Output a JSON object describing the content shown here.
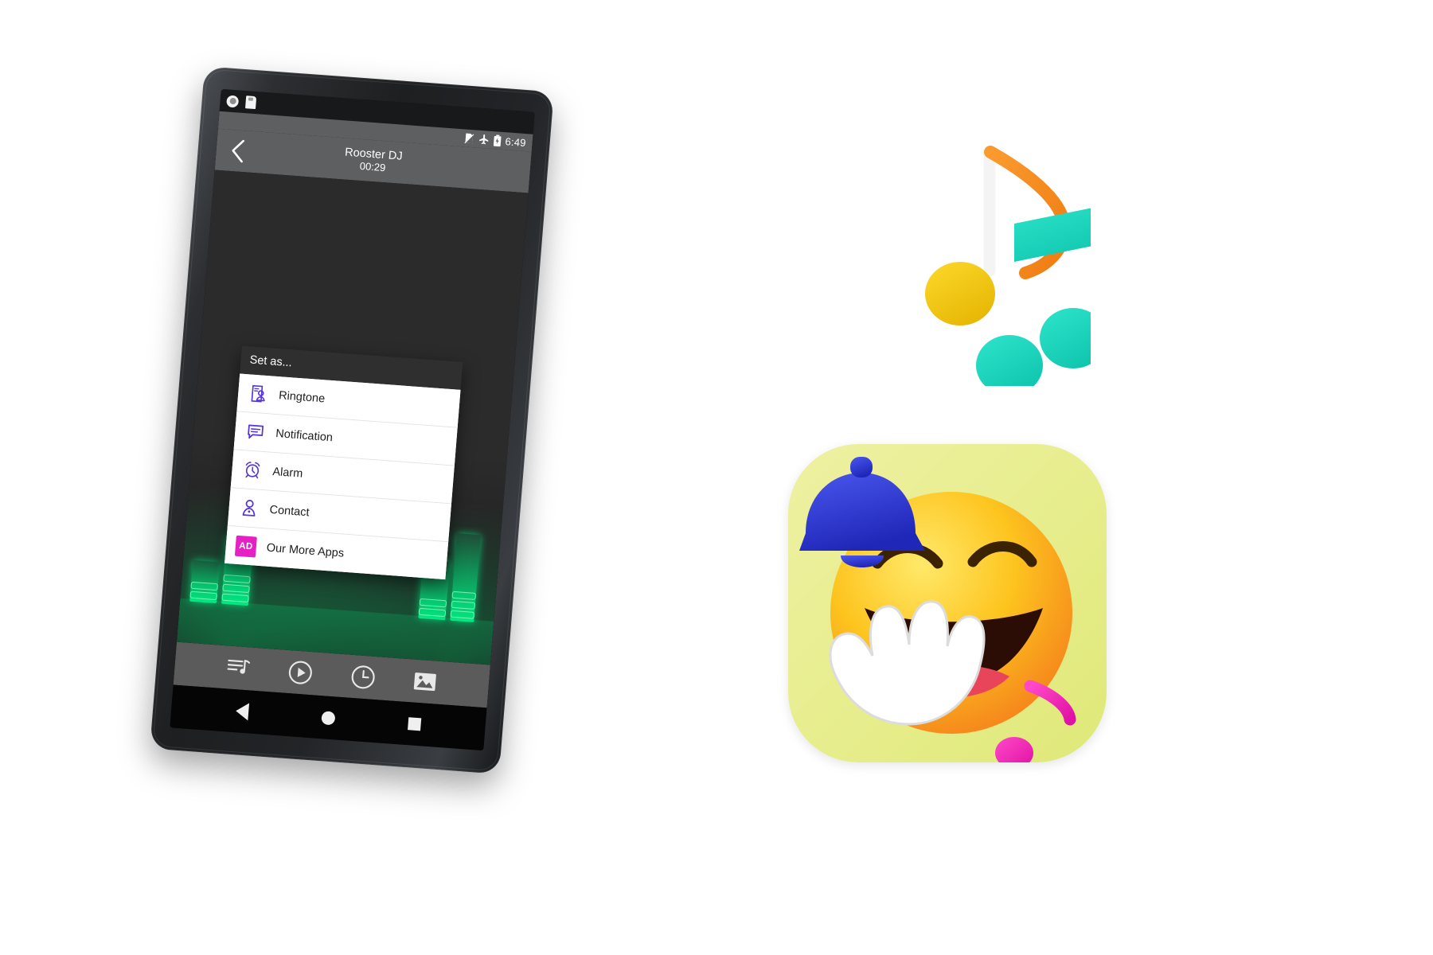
{
  "device": {
    "label": "android-tablet-mockup",
    "sensors": [
      "camera-icon",
      "sd-card-icon"
    ]
  },
  "status_bar": {
    "icons": [
      "no-sim-icon",
      "airplane-mode-icon",
      "battery-icon"
    ],
    "time": "6:49"
  },
  "action_bar": {
    "back_icon": "chevron-left-icon",
    "title": "Rooster DJ",
    "subtitle": "00:29"
  },
  "dialog": {
    "header": "Set as...",
    "items": [
      {
        "label": "Ringtone",
        "icon": "ringtone-contact-icon"
      },
      {
        "label": "Notification",
        "icon": "notification-message-icon"
      },
      {
        "label": "Alarm",
        "icon": "alarm-clock-icon"
      },
      {
        "label": "Contact",
        "icon": "contact-person-icon"
      },
      {
        "label": "Our More Apps",
        "icon": "ad-badge",
        "badge": "AD"
      }
    ],
    "accent_color": "#5533dd",
    "badge_color": "#e621c4"
  },
  "toolbar": {
    "buttons": [
      {
        "name": "playlist-button",
        "icon": "playlist-music-icon"
      },
      {
        "name": "play-button",
        "icon": "play-circle-icon"
      },
      {
        "name": "timer-button",
        "icon": "clock-icon"
      },
      {
        "name": "gallery-button",
        "icon": "image-icon"
      }
    ]
  },
  "nav_bar": {
    "buttons": [
      {
        "name": "android-back",
        "icon": "triangle-back-icon"
      },
      {
        "name": "android-home",
        "icon": "circle-home-icon"
      },
      {
        "name": "android-recents",
        "icon": "square-recents-icon"
      }
    ]
  },
  "decorations": {
    "music_notes": {
      "name": "music-notes-graphic",
      "eighth_note_stem_color": "#f5891f",
      "eighth_note_head_color": "#f5c91c",
      "beamed_note_color": "#1fd4bd"
    },
    "app_icon": {
      "name": "funny-ringtones-app-icon",
      "background_color": "#e8ee90",
      "face_color": "#f9c623",
      "bell_color": "#2b35d4",
      "note_color": "#f02fb2",
      "hand_color": "#ffffff"
    }
  }
}
